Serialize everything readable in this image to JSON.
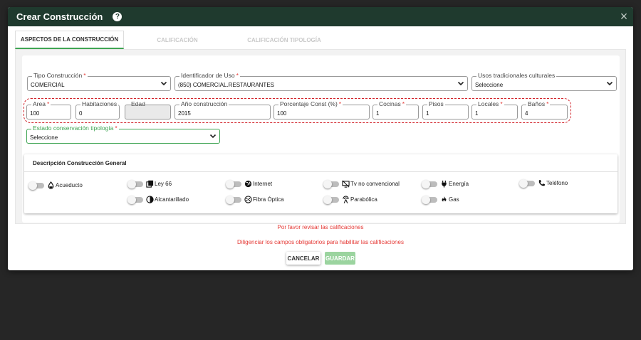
{
  "header": {
    "title": "Crear Construcción",
    "help": "?",
    "close": "×"
  },
  "tabs": [
    {
      "label": "ASPECTOS DE LA CONSTRUCCIÓN",
      "active": true
    },
    {
      "label": "CALIFICACIÓN",
      "active": false
    },
    {
      "label": "CALIFICACIÓN TIPOLOGÍA",
      "active": false
    }
  ],
  "form": {
    "tipo_construccion": {
      "label": "Tipo Construcción",
      "value": "COMERCIAL"
    },
    "identificador_uso": {
      "label": "Identificador de Uso",
      "value": "(850) COMERCIAL.RESTAURANTES"
    },
    "usos_tradicionales": {
      "label": "Usos tradicionales culturales",
      "value": "Seleccione"
    },
    "area": {
      "label": "Area",
      "value": "100"
    },
    "habitaciones": {
      "label": "Habitaciones",
      "value": "0"
    },
    "edad": {
      "label": "Edad",
      "value": ""
    },
    "anio_construccion": {
      "label": "Año construcción",
      "value": "2015"
    },
    "porcentaje_const": {
      "label": "Porcentaje Const (%)",
      "value": "100"
    },
    "cocinas": {
      "label": "Cocinas",
      "value": "1"
    },
    "pisos": {
      "label": "Pisos",
      "value": "1"
    },
    "locales": {
      "label": "Locales",
      "value": "1"
    },
    "banos": {
      "label": "Baños",
      "value": "4"
    },
    "estado_conservacion": {
      "label": "Estado conservación tipología",
      "value": "Seleccione"
    },
    "required_mark": "*"
  },
  "descripcion": {
    "title": "Descripción Construcción General",
    "services": [
      {
        "label": "Acueducto",
        "icon": "water-drop-icon",
        "on": false
      },
      {
        "label": "Ley 66",
        "icon": "copy-icon",
        "on": false
      },
      {
        "label": "Internet",
        "icon": "globe-icon",
        "on": false
      },
      {
        "label": "Tv no convencional",
        "icon": "tv-off-icon",
        "on": false
      },
      {
        "label": "Energía",
        "icon": "plug-icon",
        "on": false
      },
      {
        "label": "Teléfono",
        "icon": "phone-icon",
        "on": false
      },
      {
        "label": "Alcantarillado",
        "icon": "half-circle-icon",
        "on": false
      },
      {
        "label": "Fibra Óptica",
        "icon": "fiber-icon",
        "on": false
      },
      {
        "label": "Parabólica",
        "icon": "antenna-icon",
        "on": false
      },
      {
        "label": "Gas",
        "icon": "flame-icon",
        "on": false
      }
    ]
  },
  "messages": {
    "revisar": "Por favor revisar las calificaciones",
    "diligenciar": "Diligenciar los campos obligatorios para habilitar las calificaciones"
  },
  "buttons": {
    "cancel": "CANCELAR",
    "save": "GUARDAR"
  },
  "colors": {
    "header": "#1f3a2e",
    "accent_green": "#3fa553",
    "error_red": "#e53935",
    "save_disabled": "#9bd49f"
  }
}
